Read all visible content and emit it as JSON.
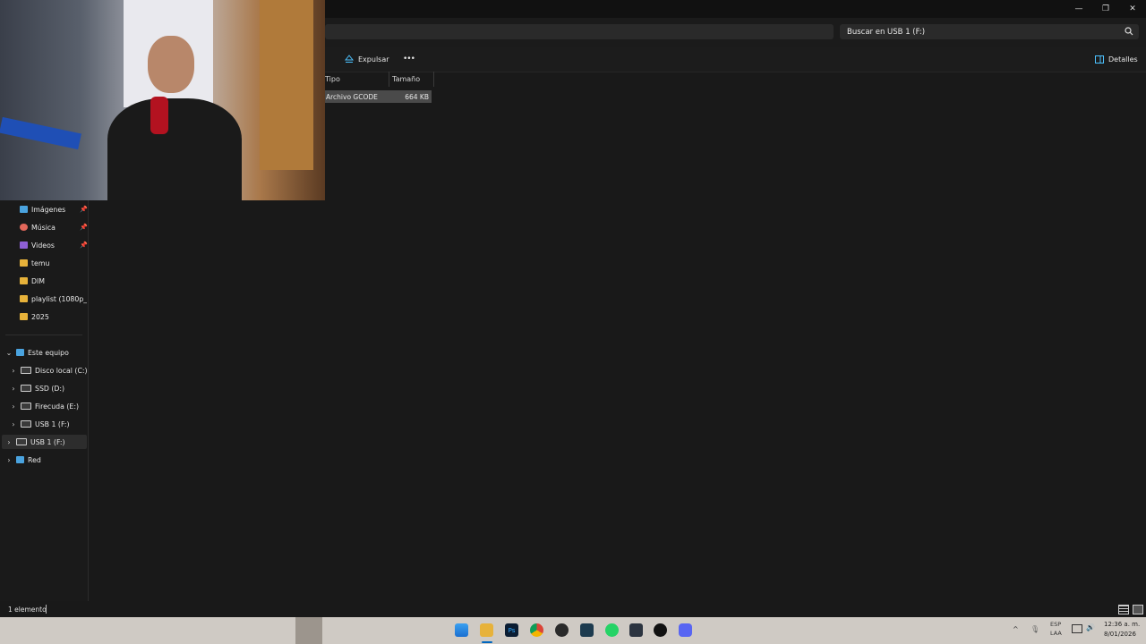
{
  "window": {
    "controls": [
      "minimize",
      "restore",
      "close"
    ]
  },
  "search": {
    "placeholder": "Buscar en USB 1 (F:)"
  },
  "toolbar": {
    "eject_label": "Expulsar",
    "more_label": "•••",
    "details_label": "Detalles"
  },
  "columns": {
    "type": "Tipo",
    "size": "Tamaño"
  },
  "file": {
    "type": "Archivo GCODE",
    "size": "664 KB"
  },
  "sidebar": {
    "quick_access": [
      {
        "label": "Imágenes",
        "icon": "pictures-icon",
        "pinned": true
      },
      {
        "label": "Música",
        "icon": "music-icon",
        "pinned": true
      },
      {
        "label": "Videos",
        "icon": "videos-icon",
        "pinned": true
      },
      {
        "label": "temu",
        "icon": "folder-icon",
        "pinned": false
      },
      {
        "label": "DIM",
        "icon": "folder-icon",
        "pinned": false
      },
      {
        "label": "playlist (1080p_aac",
        "icon": "folder-icon",
        "pinned": false
      },
      {
        "label": "2025",
        "icon": "folder-icon",
        "pinned": false
      }
    ],
    "this_pc": {
      "label": "Este equipo",
      "drives": [
        {
          "label": "Disco local (C:)"
        },
        {
          "label": "SSD (D:)"
        },
        {
          "label": "Firecuda (E:)"
        },
        {
          "label": "USB 1 (F:)"
        }
      ]
    },
    "usb": {
      "label": "USB 1 (F:)"
    },
    "network": {
      "label": "Red"
    }
  },
  "status": {
    "count": "1 elemento"
  },
  "clock": {
    "time": "12:36 a. m.",
    "date": "8/01/2026"
  },
  "tray": {
    "lang_top": "ESP",
    "lang_bottom": "LAA"
  },
  "colors": {
    "accent": "#4cc2ff",
    "folder": "#e7b23a",
    "background": "#191919"
  }
}
